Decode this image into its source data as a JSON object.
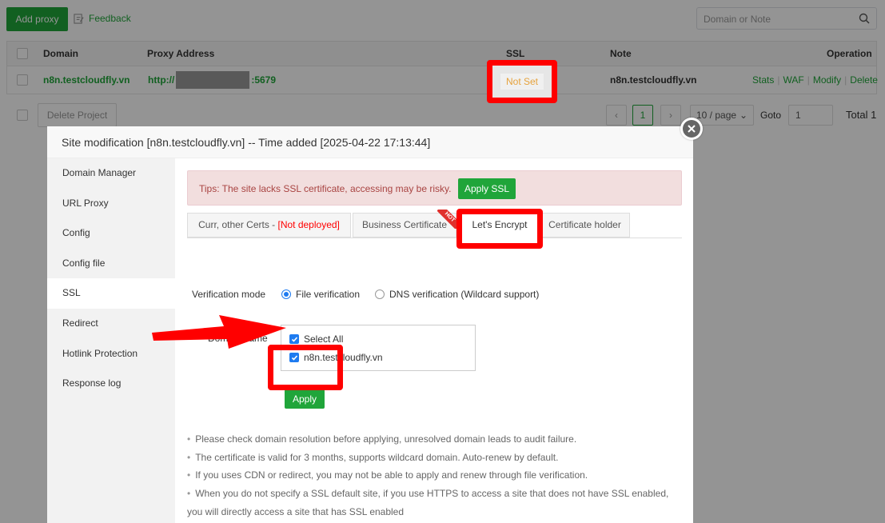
{
  "toolbar": {
    "add_proxy": "Add proxy",
    "feedback": "Feedback",
    "search_placeholder": "Domain or Note"
  },
  "table": {
    "headers": {
      "domain": "Domain",
      "proxy_address": "Proxy Address",
      "ssl": "SSL",
      "note": "Note",
      "operation": "Operation"
    },
    "rows": [
      {
        "domain": "n8n.testcloudfly.vn",
        "proxy_prefix": "http://",
        "proxy_suffix": ":5679",
        "ssl": "Not Set",
        "note": "n8n.testcloudfly.vn",
        "ops": [
          "Stats",
          "WAF",
          "Modify",
          "Delete"
        ]
      }
    ]
  },
  "footer": {
    "delete_project": "Delete Project",
    "current_page": "1",
    "per_page": "10 / page",
    "goto_label": "Goto",
    "goto_value": "1",
    "total": "Total 1"
  },
  "dialog": {
    "title": "Site modification [n8n.testcloudfly.vn] -- Time added [2025-04-22 17:13:44]",
    "sidebar": [
      "Domain Manager",
      "URL Proxy",
      "Config",
      "Config file",
      "SSL",
      "Redirect",
      "Hotlink Protection",
      "Response log"
    ],
    "active_sidebar": "SSL",
    "tips": "Tips: The site lacks SSL certificate, accessing may be risky.",
    "apply_ssl": "Apply SSL",
    "tabs": {
      "curr_prefix": "Curr, other Certs - ",
      "curr_status": "[Not deployed]",
      "business": "Business Certificate",
      "hot_badge": "HOT",
      "letsencrypt": "Let's Encrypt",
      "holder": "Certificate holder"
    },
    "verification_mode_label": "Verification mode",
    "file_verification": "File verification",
    "dns_verification": "DNS verification (Wildcard support)",
    "domain_name_label": "Domain name",
    "select_all": "Select All",
    "domain_option": "n8n.testcloudfly.vn",
    "apply": "Apply",
    "notes": [
      "Please check domain resolution before applying, unresolved domain leads to audit failure.",
      "The certificate is valid for 3 months, supports wildcard domain. Auto-renew by default.",
      "If you uses CDN or redirect, you may not be able to apply and renew through file verification.",
      "When you do not specify a SSL default site, if you use HTTPS to access a site that does not have SSL enabled,"
    ],
    "notes_continuation": "you will directly access a site that has SSL enabled"
  },
  "colors": {
    "accent_green": "#20a53a",
    "annotation_red": "#ff0000",
    "warning_bg": "#f2dede",
    "warning_text": "#a94442",
    "not_set": "#e6a23c"
  },
  "icons": [
    "feedback-icon",
    "search-icon",
    "chevron-left-icon",
    "chevron-right-icon",
    "chevron-down-icon",
    "close-icon",
    "annotation-arrow"
  ]
}
